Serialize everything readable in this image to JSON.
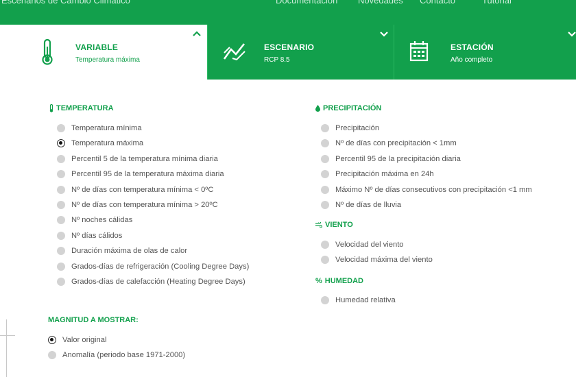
{
  "topnav": {
    "items": [
      "Escenarios de Cambio Climático",
      "Documentación",
      "Novedades",
      "Contacto",
      "Tutorial"
    ]
  },
  "tabs": [
    {
      "icon": "thermometer-icon",
      "title": "VARIABLE",
      "subtitle": "Temperatura máxima",
      "active": true,
      "expanded": true
    },
    {
      "icon": "line-chart-icon",
      "title": "ESCENARIO",
      "subtitle": "RCP 8.5",
      "active": false
    },
    {
      "icon": "calendar-icon",
      "title": "ESTACIÓN",
      "subtitle": "Año completo",
      "active": false
    }
  ],
  "temperatura": {
    "title": "TEMPERATURA",
    "options": [
      {
        "label": "Temperatura mínima",
        "checked": false
      },
      {
        "label": "Temperatura máxima",
        "checked": true
      },
      {
        "label": "Percentil 5 de la temperatura mínima diaria",
        "checked": false
      },
      {
        "label": "Percentil 95 de la temperatura máxima diaria",
        "checked": false
      },
      {
        "label": "Nº de días con temperatura mínima < 0ºC",
        "checked": false
      },
      {
        "label": "Nº de días con temperatura mínima > 20ºC",
        "checked": false
      },
      {
        "label": "Nº noches cálidas",
        "checked": false
      },
      {
        "label": "Nº días cálidos",
        "checked": false
      },
      {
        "label": "Duración máxima de olas de calor",
        "checked": false
      },
      {
        "label": "Grados-días de refrigeración (Cooling Degree Days)",
        "checked": false
      },
      {
        "label": "Grados-días de calefacción (Heating Degree Days)",
        "checked": false
      }
    ]
  },
  "precipitacion": {
    "title": "PRECIPITACIÓN",
    "options": [
      {
        "label": "Precipitación",
        "checked": false
      },
      {
        "label": "Nº de días con precipitación < 1mm",
        "checked": false
      },
      {
        "label": "Percentil 95 de la precipitación diaria",
        "checked": false
      },
      {
        "label": "Precipitación máxima en 24h",
        "checked": false
      },
      {
        "label": "Máximo Nº de días consecutivos con precipitación <1 mm",
        "checked": false
      },
      {
        "label": "Nº de días de lluvia",
        "checked": false
      }
    ]
  },
  "viento": {
    "title": "VIENTO",
    "options": [
      {
        "label": "Velocidad del viento",
        "checked": false
      },
      {
        "label": "Velocidad máxima del viento",
        "checked": false
      }
    ]
  },
  "humedad": {
    "title": "HUMEDAD",
    "options": [
      {
        "label": "Humedad relativa",
        "checked": false
      }
    ]
  },
  "magnitud": {
    "title": "MAGNITUD A MOSTRAR:",
    "options": [
      {
        "label": "Valor original",
        "checked": true
      },
      {
        "label": "Anomalía (periodo base 1971-2000)",
        "checked": false
      }
    ]
  },
  "colors": {
    "brand_green": "#12a04c",
    "radio_grey": "#d3d3d3"
  }
}
